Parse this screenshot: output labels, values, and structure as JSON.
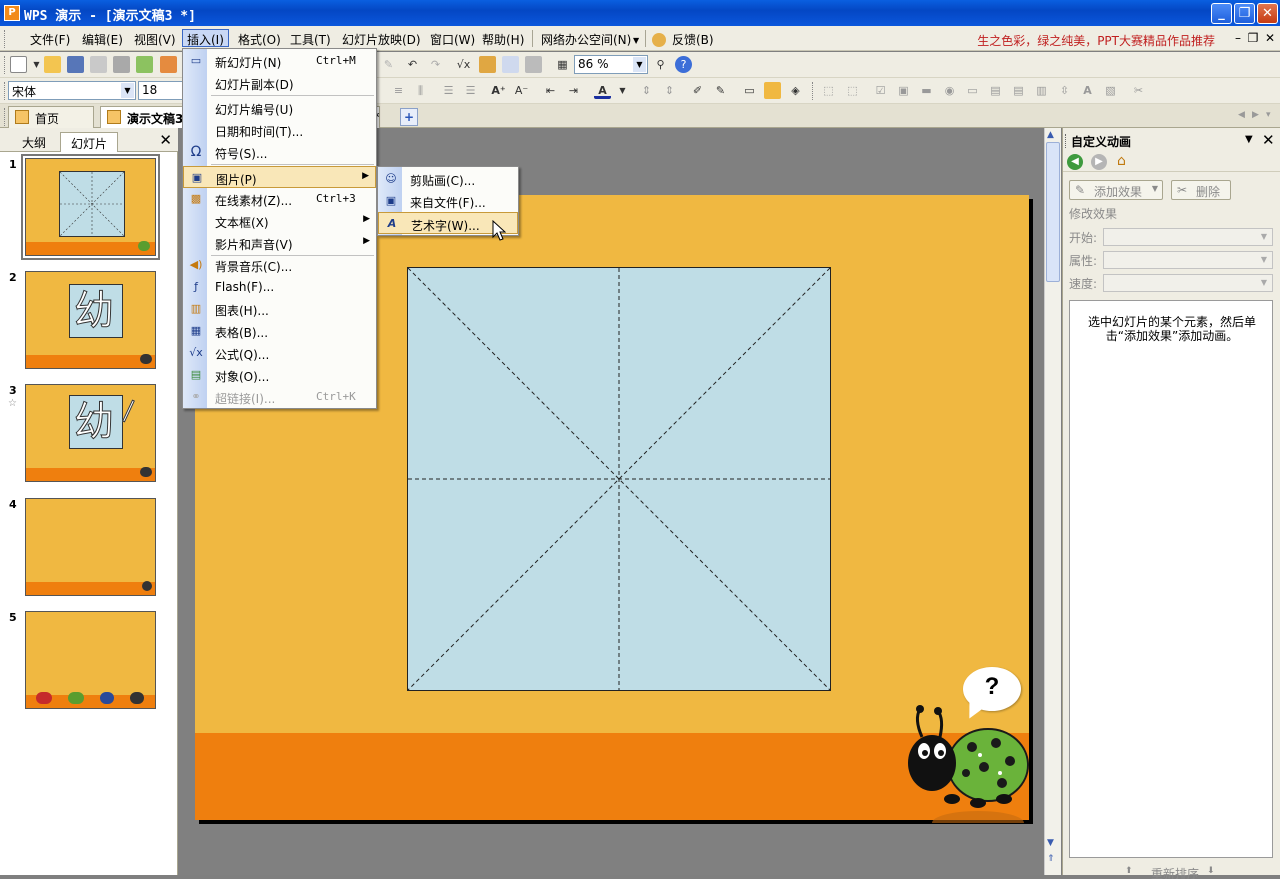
{
  "window": {
    "title": "WPS 演示 - [演示文稿3 *]",
    "app_icon_letter": "P"
  },
  "menubar": {
    "items": [
      "文件(F)",
      "编辑(E)",
      "视图(V)",
      "插入(I)",
      "格式(O)",
      "工具(T)",
      "幻灯片放映(D)",
      "窗口(W)",
      "帮助(H)",
      "网络办公空间(N)",
      "反馈(B)"
    ],
    "promo": "生之色彩，绿之纯美，PPT大赛精品作品推荐"
  },
  "toolbar": {
    "zoom_value": "86 %",
    "font_name": "宋体",
    "font_size": "18"
  },
  "tabs": {
    "home": "首页",
    "doc": "演示文稿3"
  },
  "left_pane": {
    "tab_outline": "大纲",
    "tab_slides": "幻灯片",
    "slide_numbers": [
      "1",
      "2",
      "3",
      "4",
      "5"
    ],
    "thumb_char": "幼"
  },
  "insert_menu": {
    "items": [
      {
        "label": "新幻灯片(N)",
        "shortcut": "Ctrl+M"
      },
      {
        "label": "幻灯片副本(D)",
        "shortcut": ""
      },
      {
        "label": "幻灯片编号(U)",
        "shortcut": ""
      },
      {
        "label": "日期和时间(T)...",
        "shortcut": ""
      },
      {
        "label": "符号(S)...",
        "shortcut": ""
      },
      {
        "label": "图片(P)",
        "shortcut": ""
      },
      {
        "label": "在线素材(Z)...",
        "shortcut": "Ctrl+3"
      },
      {
        "label": "文本框(X)",
        "shortcut": ""
      },
      {
        "label": "影片和声音(V)",
        "shortcut": ""
      },
      {
        "label": "背景音乐(C)...",
        "shortcut": ""
      },
      {
        "label": "Flash(F)...",
        "shortcut": ""
      },
      {
        "label": "图表(H)...",
        "shortcut": ""
      },
      {
        "label": "表格(B)...",
        "shortcut": ""
      },
      {
        "label": "公式(Q)...",
        "shortcut": ""
      },
      {
        "label": "对象(O)...",
        "shortcut": ""
      },
      {
        "label": "超链接(I)...",
        "shortcut": "Ctrl+K"
      }
    ]
  },
  "picture_submenu": {
    "items": [
      "剪贴画(C)...",
      "来自文件(F)...",
      "艺术字(W)..."
    ]
  },
  "task_pane": {
    "title": "自定义动画",
    "add_effect": "添加效果",
    "delete": "删除",
    "modify_effect": "修改效果",
    "start_label": "开始:",
    "property_label": "属性:",
    "speed_label": "速度:",
    "hint": "选中幻灯片的某个元素，然后单击“添加效果”添加动画。",
    "reorder": "重新排序"
  },
  "slide": {
    "bubble_text": "?"
  },
  "colors": {
    "slide_bg": "#f0b841",
    "slide_band": "#ef7f0e",
    "grid_bg": "#bfdde6",
    "titlebar": "#0447c4"
  }
}
